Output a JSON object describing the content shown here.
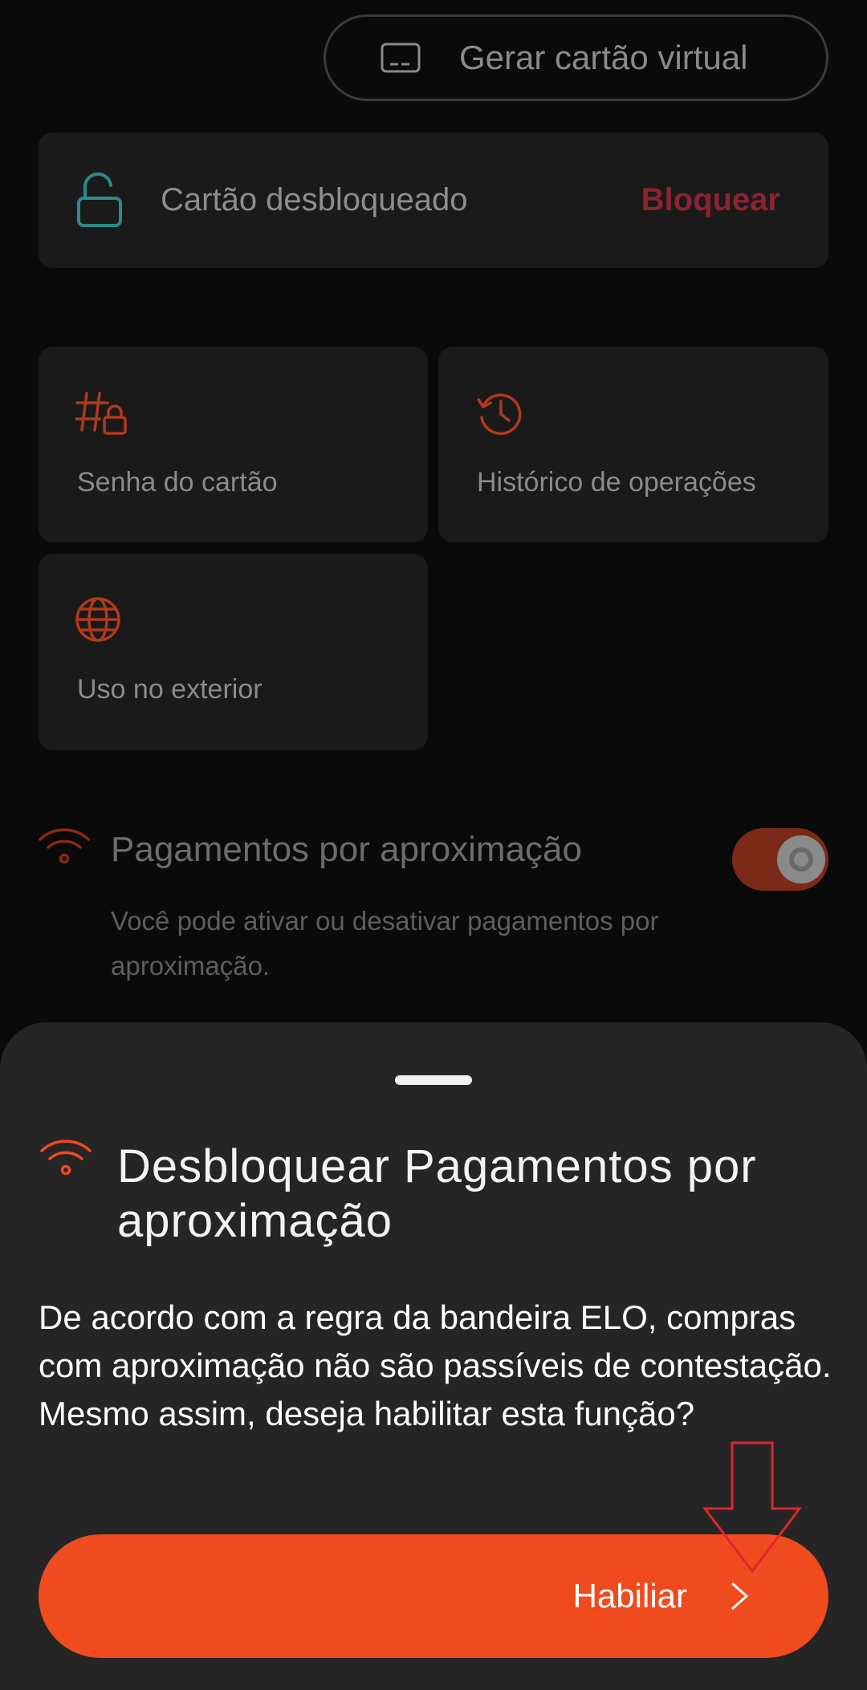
{
  "virtual_card": {
    "label": "Gerar cartão virtual",
    "icon": "card-icon"
  },
  "lock_status": {
    "label": "Cartão desbloqueado",
    "action": "Bloquear",
    "icon": "unlock-icon"
  },
  "tiles": [
    {
      "label": "Senha do cartão",
      "icon": "hash-lock-icon"
    },
    {
      "label": "Histórico de operações",
      "icon": "history-icon"
    },
    {
      "label": "Uso no exterior",
      "icon": "globe-icon"
    }
  ],
  "contactless": {
    "title": "Pagamentos por aproximação",
    "description": "Você pode ativar ou desativar pagamentos por aproximação.",
    "icon": "nfc-icon",
    "toggle_on": true
  },
  "sheet": {
    "title": "Desbloquear Pagamentos por aproximação",
    "body": "De acordo com a regra da bandeira ELO, compras com aproximação não são passíveis de contestação. Mesmo assim, deseja habilitar esta função?",
    "cta": "Habiliar",
    "icon": "nfc-icon"
  },
  "colors": {
    "accent": "#f04a1f",
    "danger": "#8b2331",
    "teal": "#2a8a8a",
    "sheet_bg": "#252525"
  }
}
